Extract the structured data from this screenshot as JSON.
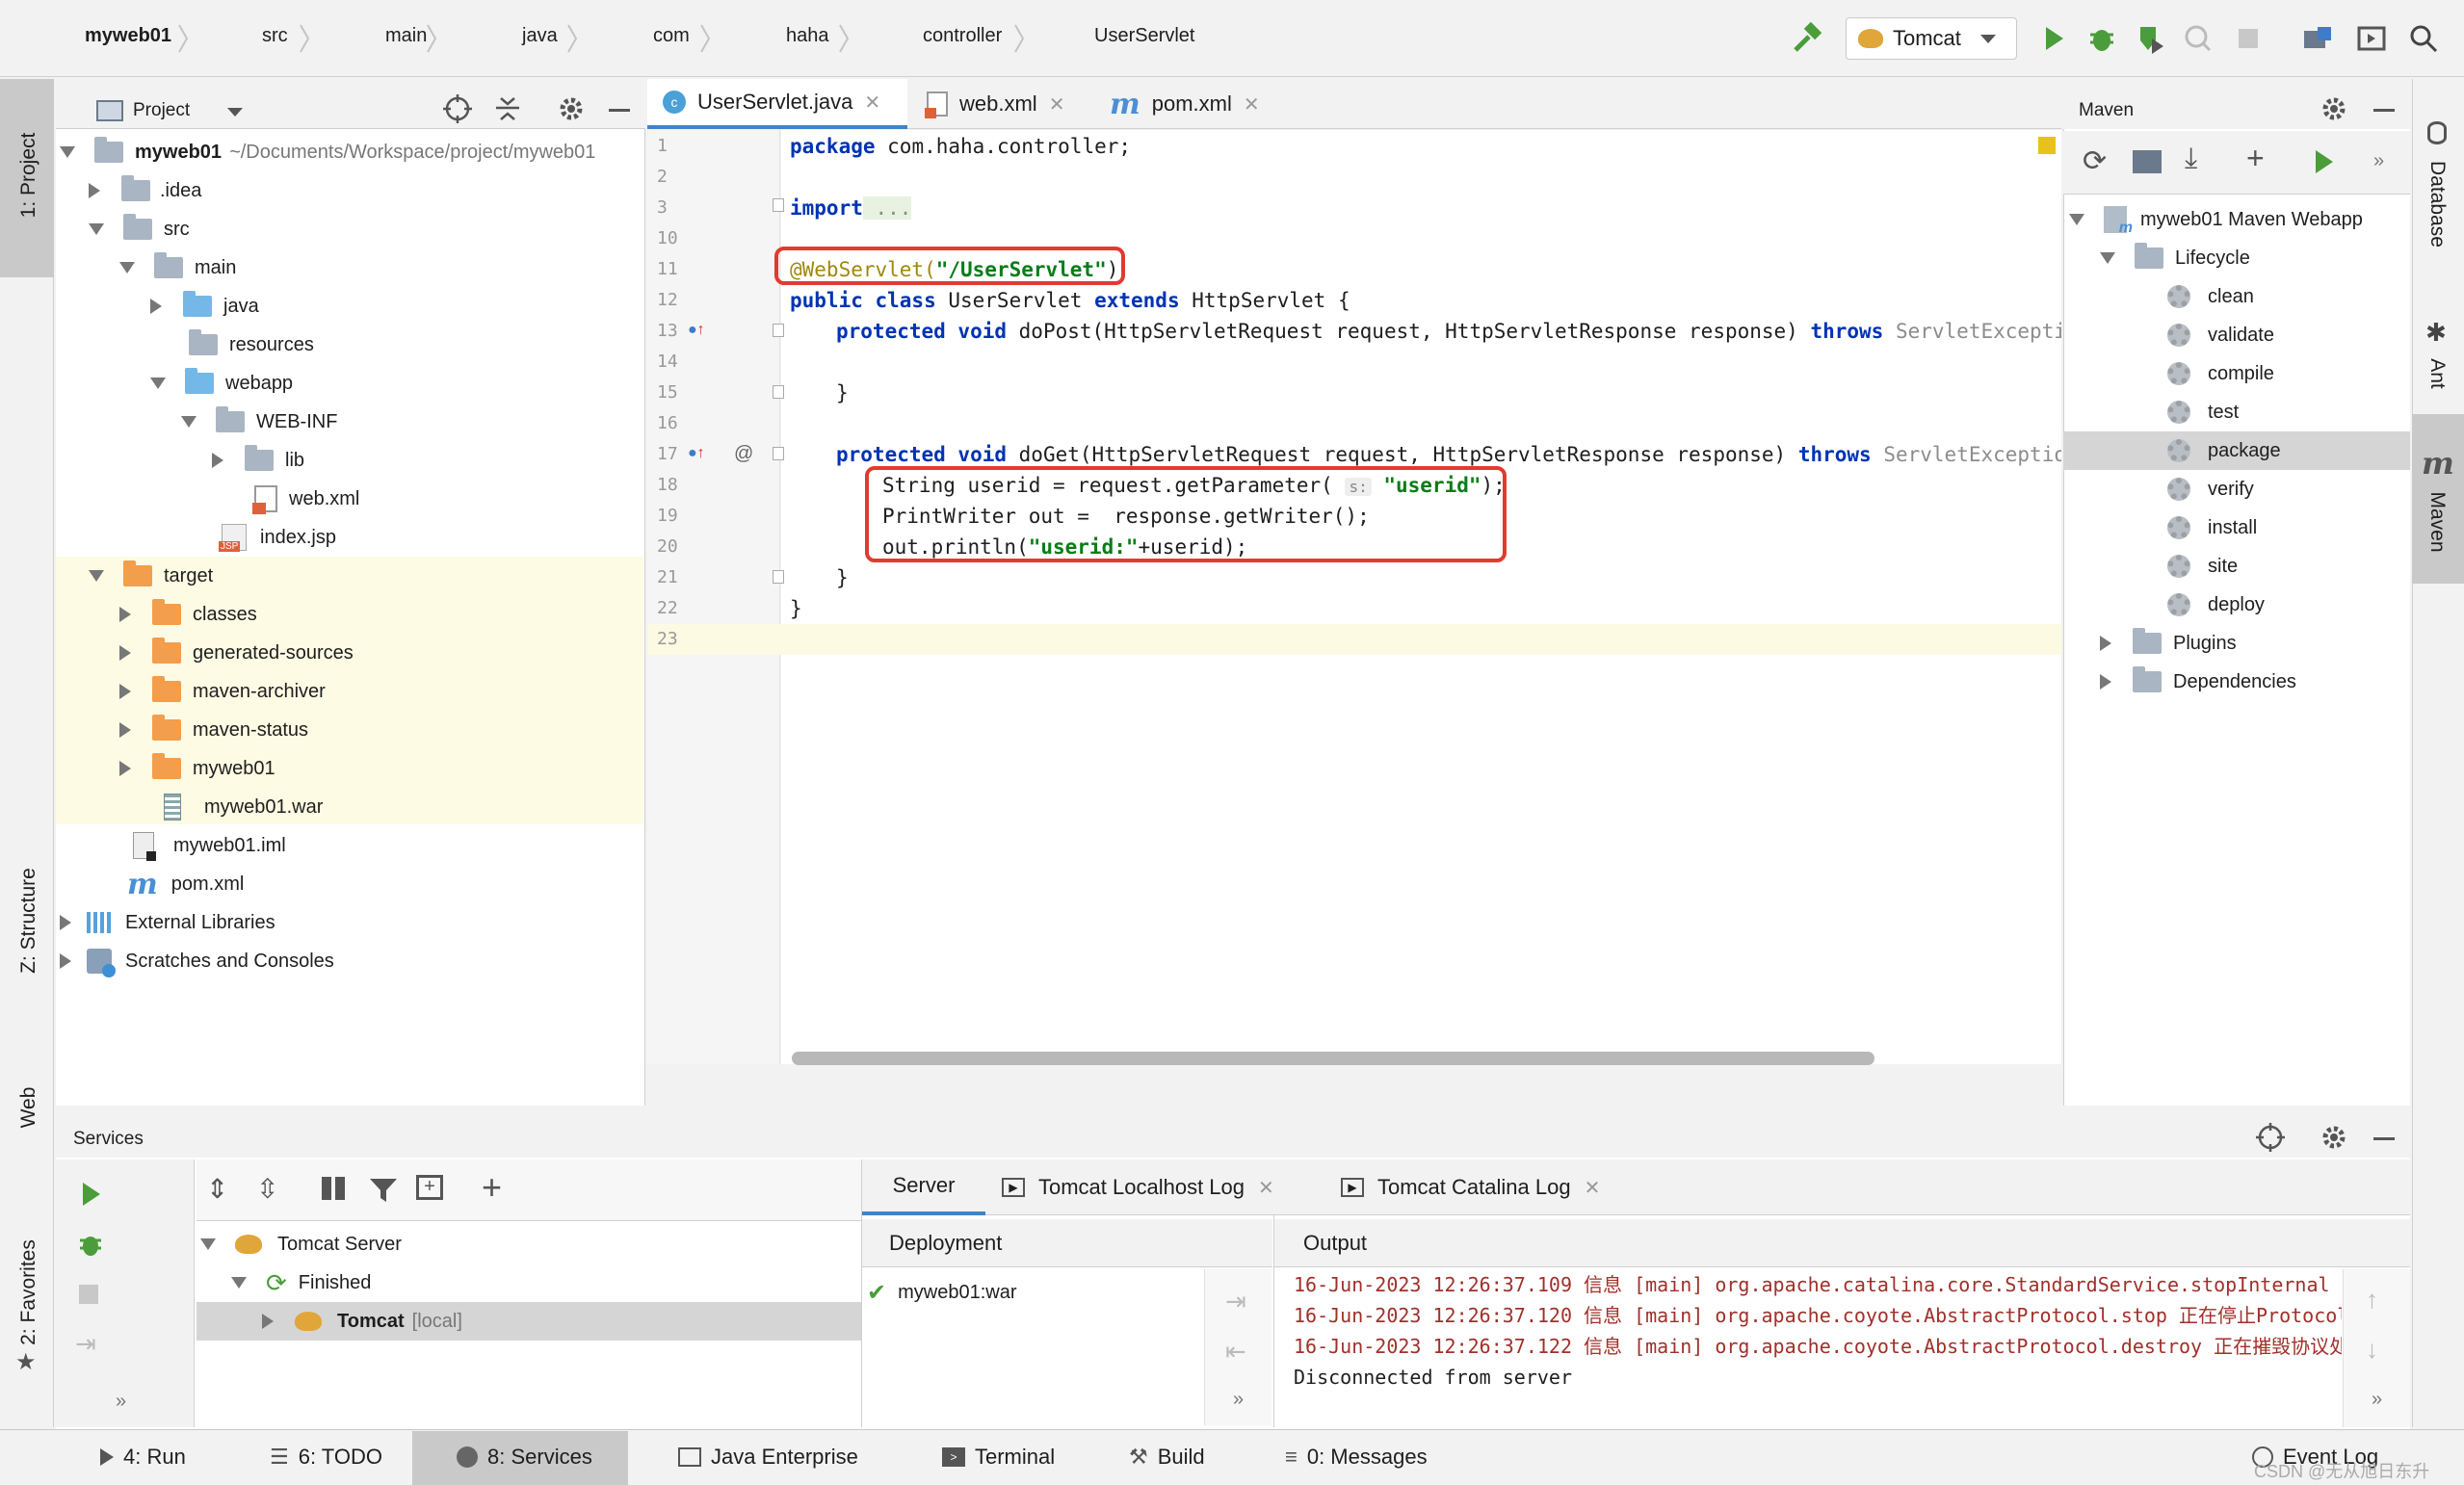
{
  "breadcrumbs": [
    "myweb01",
    "src",
    "main",
    "java",
    "com",
    "haha",
    "controller",
    "UserServlet"
  ],
  "run_config": "Tomcat",
  "left_strip": {
    "project": "1: Project",
    "structure": "Z: Structure",
    "web": "Web",
    "favorites": "2: Favorites"
  },
  "right_strip": {
    "database": "Database",
    "ant": "Ant",
    "maven": "Maven"
  },
  "project_panel": {
    "title": "Project",
    "root": {
      "name": "myweb01",
      "path": "~/Documents/Workspace/project/myweb01"
    },
    "items": [
      ".idea",
      "src",
      "main",
      "java",
      "resources",
      "webapp",
      "WEB-INF",
      "lib",
      "web.xml",
      "index.jsp",
      "target",
      "classes",
      "generated-sources",
      "maven-archiver",
      "maven-status",
      "myweb01",
      "myweb01.war",
      "myweb01.iml",
      "pom.xml",
      "External Libraries",
      "Scratches and Consoles"
    ]
  },
  "editor": {
    "tabs": [
      "UserServlet.java",
      "web.xml",
      "pom.xml"
    ],
    "line_numbers": [
      "1",
      "2",
      "3",
      "10",
      "11",
      "12",
      "13",
      "14",
      "15",
      "16",
      "17",
      "18",
      "19",
      "20",
      "21",
      "22",
      "23"
    ],
    "code": {
      "l1_kw": "package",
      "l1_rest": " com.haha.controller;",
      "l3_kw": "import",
      "l3_rest": " ...",
      "l11_ann": "@WebServlet(",
      "l11_str": "\"/UserServlet\"",
      "l11_end": ")",
      "l12_kw1": "public class",
      "l12_mid": " UserServlet ",
      "l12_kw2": "extends",
      "l12_end": " HttpServlet {",
      "l13_kw": "protected void",
      "l13_mid": " doPost(HttpServletRequest request, HttpServletResponse response) ",
      "l13_kw2": "throws",
      "l13_gray": " ServletException, I",
      "l15": "}",
      "l17_kw": "protected void",
      "l17_mid": " doGet(HttpServletRequest request, HttpServletResponse response) ",
      "l17_kw2": "throws",
      "l17_gray": " ServletException, IO",
      "l18_a": "String userid = request.getParameter( ",
      "l18_hint": "s:",
      "l18_str": "\"userid\"",
      "l18_end": ");",
      "l19": "PrintWriter out =  response.getWriter();",
      "l20_a": "out.println(",
      "l20_str": "\"userid:\"",
      "l20_end": "+userid);",
      "l21": "}",
      "l22": "}"
    }
  },
  "maven": {
    "title": "Maven",
    "project": "myweb01 Maven Webapp",
    "lifecycle": "Lifecycle",
    "phases": [
      "clean",
      "validate",
      "compile",
      "test",
      "package",
      "verify",
      "install",
      "site",
      "deploy"
    ],
    "plugins": "Plugins",
    "dependencies": "Dependencies"
  },
  "services": {
    "title": "Services",
    "tree": {
      "server": "Tomcat Server",
      "finished": "Finished",
      "tomcat": "Tomcat",
      "local": "[local]"
    },
    "tabs": [
      "Server",
      "Tomcat Localhost Log",
      "Tomcat Catalina Log"
    ],
    "deployment_header": "Deployment",
    "output_header": "Output",
    "deployment_item": "myweb01:war",
    "log": [
      "16-Jun-2023 12:26:37.109 信息 [main] org.apache.catalina.core.StandardService.stopInternal",
      "16-Jun-2023 12:26:37.120 信息 [main] org.apache.coyote.AbstractProtocol.stop 正在停止Protocol",
      "16-Jun-2023 12:26:37.122 信息 [main] org.apache.coyote.AbstractProtocol.destroy 正在摧毁协议处",
      "Disconnected from server"
    ]
  },
  "bottom_bar": {
    "run": "4: Run",
    "todo": "6: TODO",
    "services": "8: Services",
    "java_enterprise": "Java Enterprise",
    "terminal": "Terminal",
    "build": "Build",
    "messages": "0: Messages",
    "event_log": "Event Log",
    "watermark": "CSDN @无从旭日东升"
  }
}
